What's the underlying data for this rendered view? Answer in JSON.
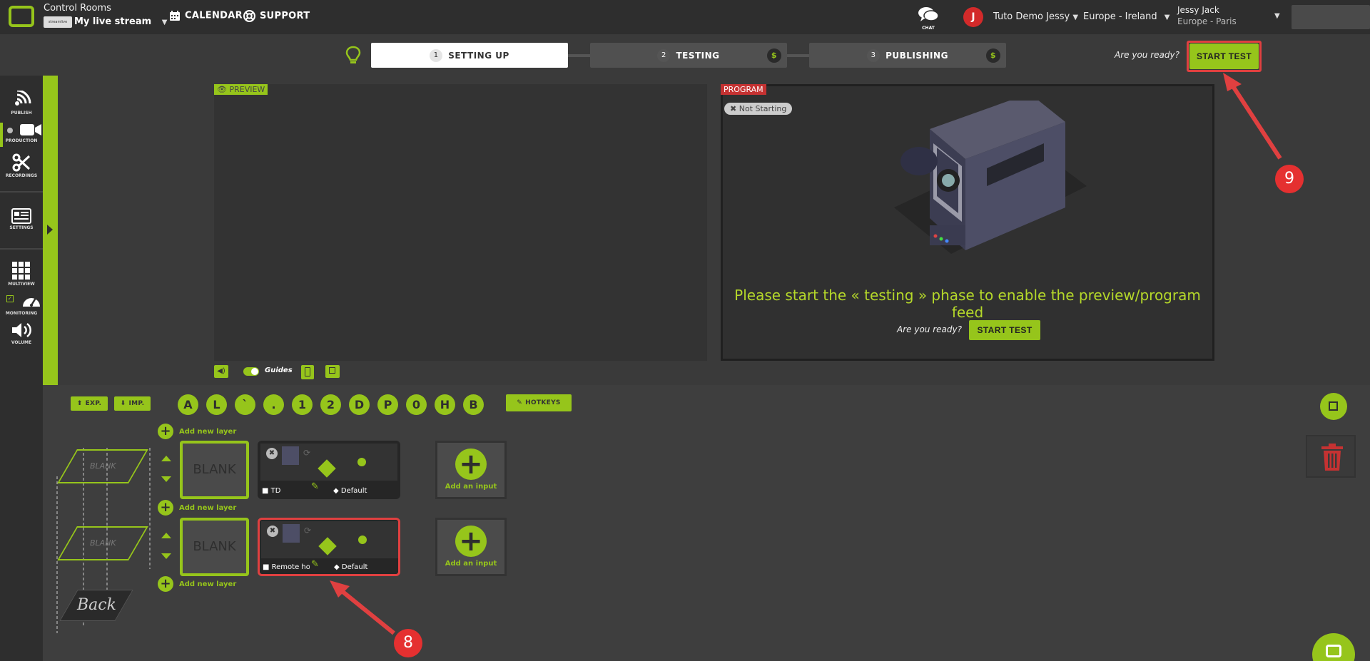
{
  "header": {
    "app_title": "Control Rooms",
    "logo_text": "streamlive",
    "stream_name": "My live stream",
    "nav": [
      {
        "label": "CALENDAR"
      },
      {
        "label": "SUPPORT"
      }
    ],
    "chat_label": "CHAT",
    "user_initial": "J",
    "user_name": "Tuto Demo Jessy",
    "region": "Europe - Ireland",
    "account_name": "Jessy Jack",
    "account_region": "Europe - Paris"
  },
  "steps": [
    {
      "num": "1",
      "label": "SETTING UP"
    },
    {
      "num": "2",
      "label": "TESTING",
      "badge": "$"
    },
    {
      "num": "3",
      "label": "PUBLISHING",
      "badge": "$"
    }
  ],
  "ready_text": "Are you ready?",
  "start_test_label": "START TEST",
  "sidebar": {
    "items": [
      {
        "label": "PUBLISH"
      },
      {
        "label": "PRODUCTION"
      },
      {
        "label": "RECORDINGS"
      },
      {
        "label": "SETTINGS"
      },
      {
        "label": "MULTIVIEW"
      },
      {
        "label": "MONITORING"
      },
      {
        "label": "VOLUME"
      }
    ]
  },
  "preview": {
    "tag": "PREVIEW",
    "guides_label": "Guides"
  },
  "program": {
    "tag": "PROGRAM",
    "status": "Not Starting",
    "message": "Please start the « testing » phase to enable the preview/program feed",
    "ready_text": "Are you ready?",
    "button": "START TEST"
  },
  "production": {
    "export_label": "EXP.",
    "import_label": "IMP.",
    "hotkeys": [
      "A",
      "L",
      "`",
      ".",
      "1",
      "2",
      "D",
      "P",
      "0",
      "H",
      "B"
    ],
    "hotkeys_label": "HOTKEYS",
    "add_layer_label": "Add new layer",
    "blank_label": "BLANK",
    "back_label": "Back",
    "add_input_label": "Add an input",
    "layers": [
      {
        "source_name": "TD",
        "preset": "Default"
      },
      {
        "source_name": "Remote ho",
        "preset": "Default"
      }
    ]
  },
  "annotations": [
    {
      "number": "9"
    },
    {
      "number": "8"
    }
  ],
  "colors": {
    "accent": "#96c51b",
    "danger": "#d32a2a",
    "background": "#3a3a3a"
  }
}
